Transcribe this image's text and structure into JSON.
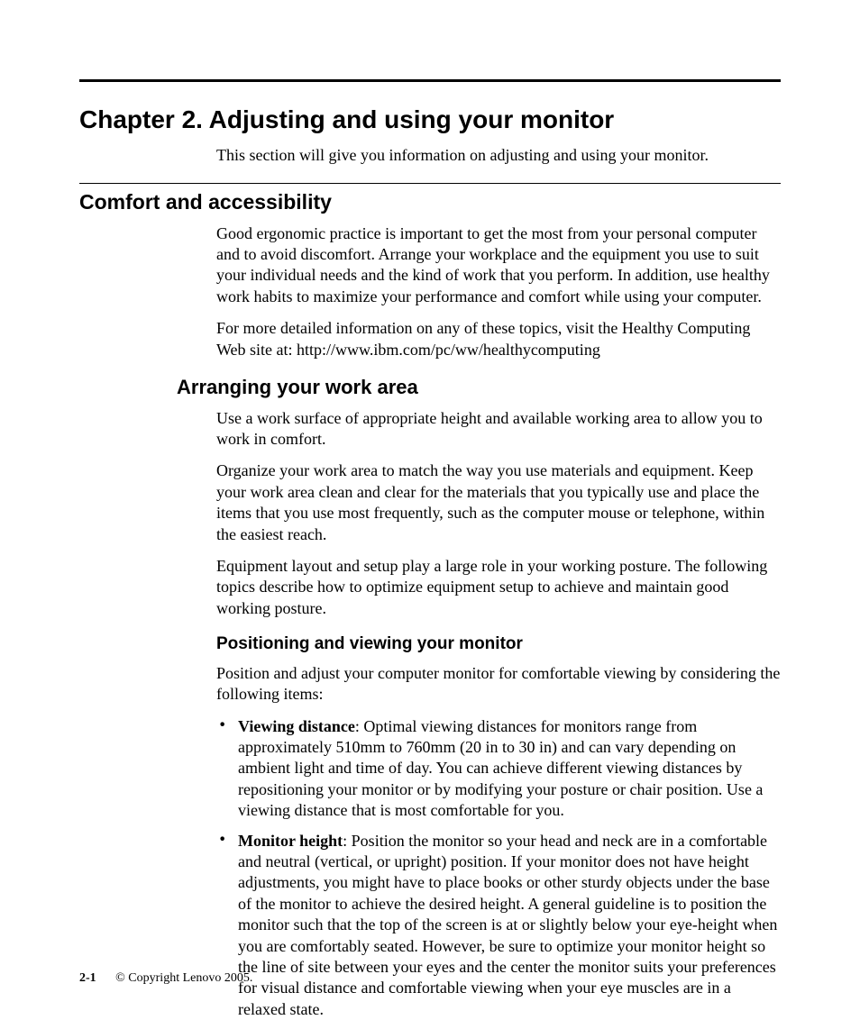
{
  "chapter_title": "Chapter 2. Adjusting and using your monitor",
  "intro": "This section will give you information on adjusting and using your monitor.",
  "section1": {
    "heading": "Comfort and accessibility",
    "p1": "Good ergonomic practice is important to get the most from your personal computer and to avoid discomfort. Arrange your workplace and the equipment you use to suit your individual needs and the kind of work that you perform. In addition, use healthy work habits to maximize your performance and comfort while using your computer.",
    "p2": "For more detailed information on any of these topics, visit the Healthy Computing Web site at: http://www.ibm.com/pc/ww/healthycomputing"
  },
  "section2": {
    "heading": "Arranging your work area",
    "p1": "Use a work surface of appropriate height and available working area to allow you to work in comfort.",
    "p2": "Organize your work area to match the way you use materials and equipment. Keep your work area clean and clear for the materials that you typically use and place the items that you use most frequently, such as the computer mouse or telephone, within the easiest reach.",
    "p3": "Equipment layout and setup play a large role in your working posture. The following topics describe how to optimize equipment setup to achieve and maintain good working posture."
  },
  "section3": {
    "heading": "Positioning and viewing your monitor",
    "intro": "Position and adjust your computer monitor for comfortable viewing by considering the following items:",
    "bullets": [
      {
        "label": "Viewing distance",
        "text": ": Optimal viewing distances for monitors range from approximately 510mm to 760mm (20 in to 30 in) and can vary depending on ambient light and time of day. You can achieve different viewing distances by repositioning your monitor or by modifying your posture or chair position. Use a viewing distance that is most comfortable for you."
      },
      {
        "label": "Monitor height",
        "text": ": Position the monitor so your head and neck are in a comfortable and neutral (vertical, or upright) position. If your monitor does not have height adjustments, you might have to place books or other sturdy objects under the base of the monitor to achieve the desired height. A general guideline is to position the monitor such that the top of the screen is at or slightly below your eye-height when you are comfortably seated. However, be sure to optimize your monitor height so the line of site between your eyes and the center the monitor suits your preferences for visual distance and comfortable viewing when your eye muscles are in a relaxed state."
      }
    ]
  },
  "footer": {
    "page": "2-1",
    "copyright": "© Copyright Lenovo 2005."
  }
}
